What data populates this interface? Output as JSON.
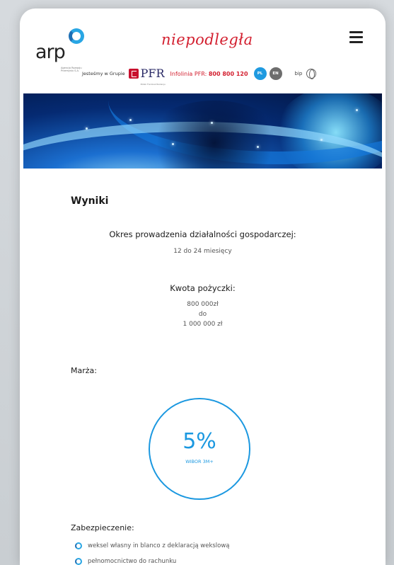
{
  "header": {
    "logo_text": "arp",
    "logo_subtext": "Agencja Rozwoju Przemysłu S.A.",
    "niepodlegla": "niepodległa",
    "group_label": "Jesteśmy w Grupie",
    "pfr_label": "PFR",
    "pfr_sub": "Polski Fundusz Rozwoju",
    "infolinia_label": "Infolinia PFR:",
    "infolinia_number": "800 800 120",
    "lang_pl": "PL",
    "lang_en": "EN",
    "bip_label": "bip"
  },
  "results": {
    "title": "Wyniki",
    "period_label": "Okres prowadzenia działalności gospodarczej:",
    "period_value": "12 do 24 miesięcy",
    "loan_label": "Kwota pożyczki:",
    "loan_from": "800 000zł",
    "loan_to_word": "do",
    "loan_to": "1 000 000 zł",
    "margin_label": "Marża:",
    "margin_value": "5%",
    "margin_sub": "WIBOR 3M+",
    "collateral_label": "Zabezpieczenie:",
    "collateral_items": [
      "weksel własny in blanco z deklaracją wekslową",
      "pełnomocnictwo do rachunku"
    ]
  },
  "colors": {
    "accent": "#1b98e0",
    "brand_red": "#d32030"
  }
}
